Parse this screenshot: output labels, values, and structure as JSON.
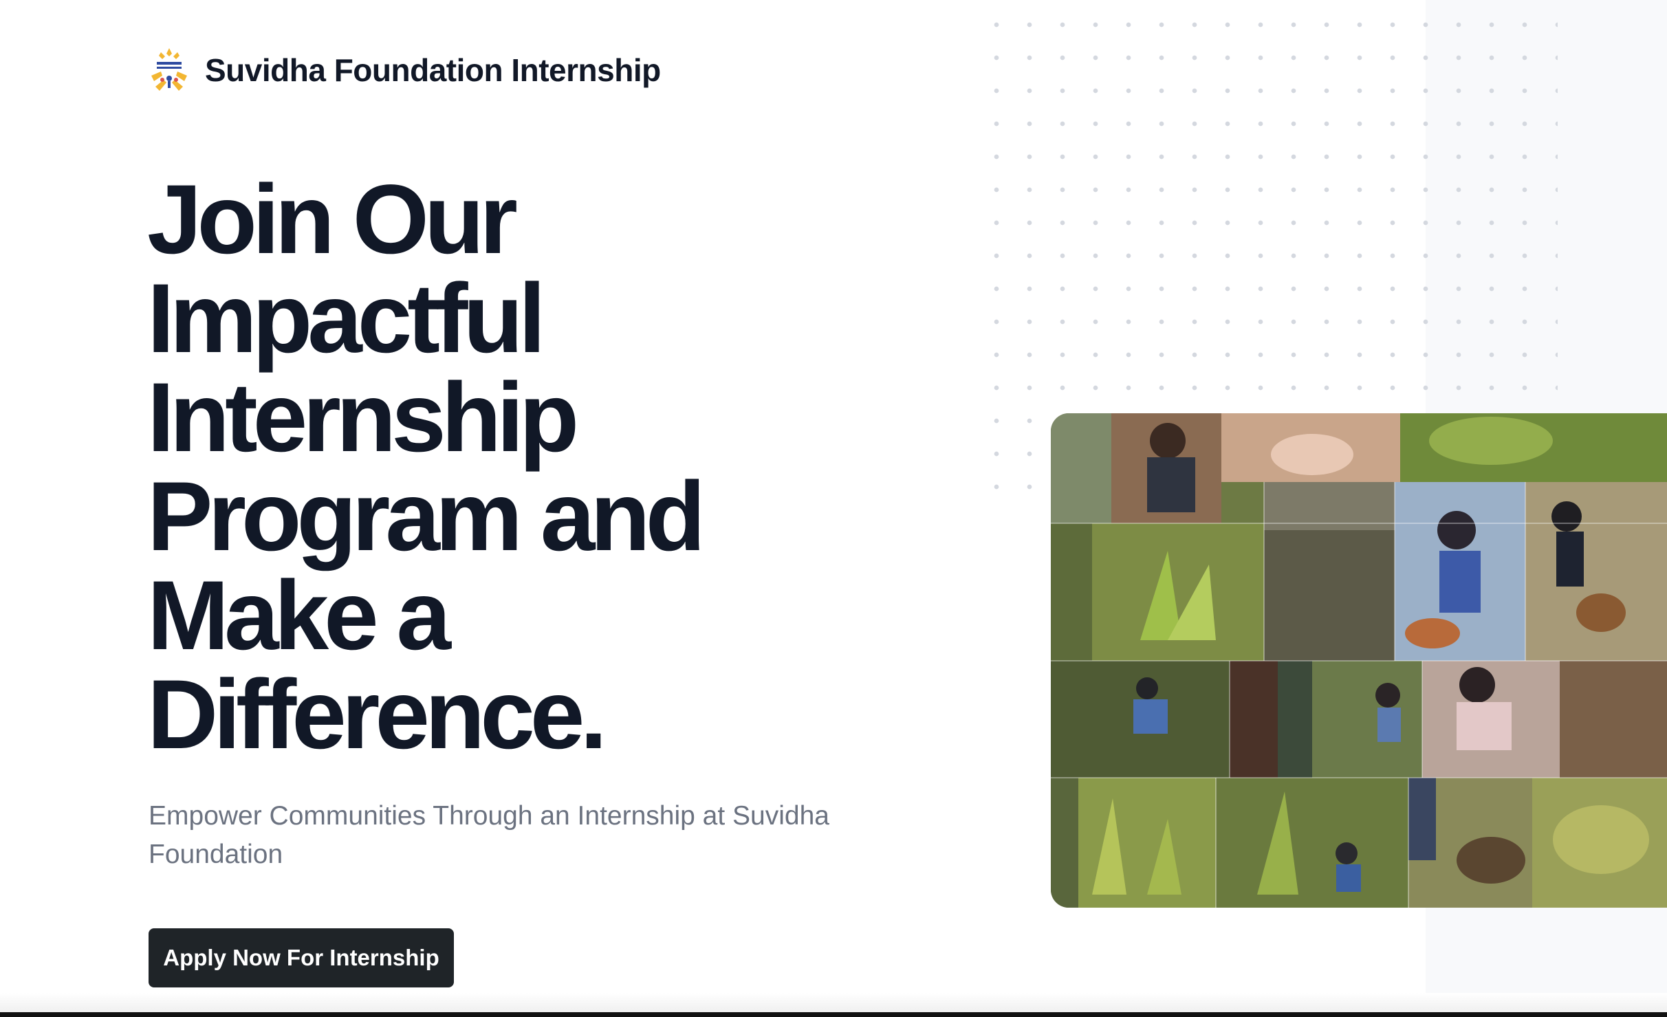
{
  "brand": {
    "name": "Suvidha Foundation Internship",
    "logo_icon": "suvidha-foundation-logo-icon"
  },
  "hero": {
    "headline_lines": [
      "Join Our",
      "Impactful",
      "Internship",
      "Program and",
      "Make a",
      "Difference."
    ],
    "subtitle": "Empower Communities Through an Internship at Suvidha Foundation",
    "cta_label": "Apply Now For Internship"
  },
  "collage": {
    "image_icon": "tree-planting-photo-collage"
  },
  "colors": {
    "heading": "#111827",
    "subtitle": "#6b7280",
    "button_bg": "#1f2428",
    "button_text": "#ffffff",
    "panel_bg": "#f8f9fb",
    "dot": "#d4d8df",
    "logo_gold": "#f2b632",
    "logo_blue": "#2d4aa0"
  }
}
